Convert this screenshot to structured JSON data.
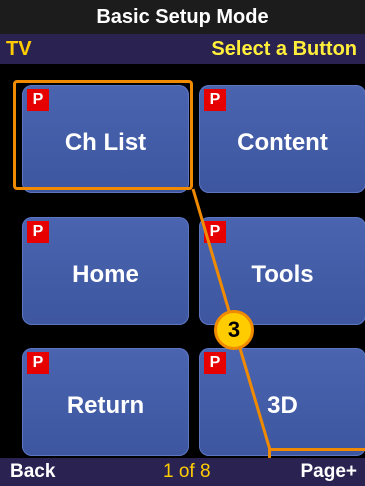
{
  "header": {
    "title": "Basic Setup Mode"
  },
  "subheader": {
    "device": "TV",
    "instruction": "Select a Button"
  },
  "buttons": [
    {
      "badge": "P",
      "label": "Ch List"
    },
    {
      "badge": "P",
      "label": "Content"
    },
    {
      "badge": "P",
      "label": "Home"
    },
    {
      "badge": "P",
      "label": "Tools"
    },
    {
      "badge": "P",
      "label": "Return"
    },
    {
      "badge": "P",
      "label": "3D"
    }
  ],
  "callout": {
    "step": "3"
  },
  "footer": {
    "back": "Back",
    "page": "1 of 8",
    "next": "Page+"
  },
  "colors": {
    "accent": "#f08a00",
    "tile": "#4a64b0",
    "badge": "#e60000",
    "highlight_text": "#ffcc00"
  }
}
